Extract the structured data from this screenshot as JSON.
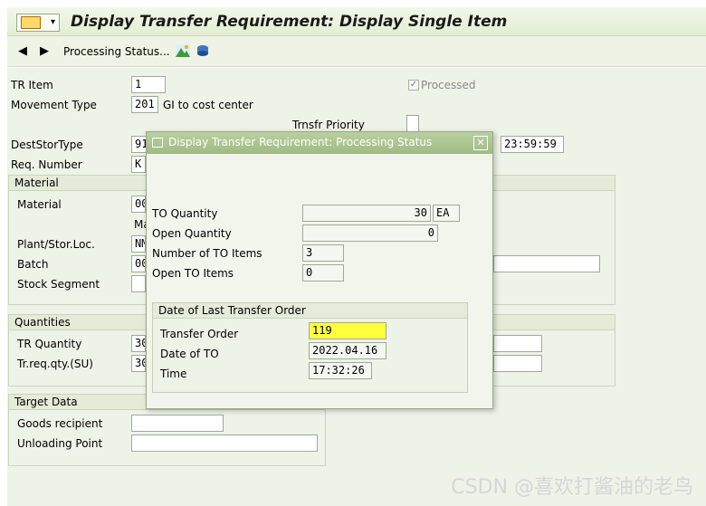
{
  "title": "Display Transfer Requirement: Display Single Item",
  "toolbar": {
    "back_icon": "triangle-left-icon",
    "forward_icon": "triangle-right-icon",
    "processing_status": "Processing Status...",
    "icon1": "mountain-landscape-icon",
    "icon2": "stack-icon"
  },
  "header": {
    "tr_item_label": "TR Item",
    "tr_item": "1",
    "processed_label": "Processed",
    "movement_type_label": "Movement Type",
    "movement_type": "201",
    "movement_type_desc": "GI to cost center",
    "trnsfr_priority_label": "Trnsfr Priority",
    "dest_stor_type_label": "DestStorType",
    "dest_stor_type": "91",
    "time_right": "23:59:59",
    "req_number_label": "Req. Number",
    "req_number": "K"
  },
  "material_group": {
    "title": "Material",
    "material_label": "Material",
    "material_value": "00",
    "ma_text": "Ma",
    "plant_label": "Plant/Stor.Loc.",
    "plant_value": "NM",
    "batch_label": "Batch",
    "batch_value": "00",
    "stock_segment_label": "Stock Segment"
  },
  "quantities_group": {
    "title": "Quantities",
    "tr_quantity_label": "TR Quantity",
    "tr_quantity": "30",
    "tr_req_qty_label": "Tr.req.qty.(SU)",
    "tr_req_qty": "30"
  },
  "target_group": {
    "title": "Target Data",
    "goods_recipient_label": "Goods recipient",
    "unloading_point_label": "Unloading Point"
  },
  "dialog": {
    "title": "Display Transfer Requirement: Processing Status",
    "to_quantity_label": "TO Quantity",
    "to_quantity": "30",
    "to_unit": "EA",
    "open_quantity_label": "Open Quantity",
    "open_quantity": "0",
    "num_to_items_label": "Number of TO Items",
    "num_to_items": "3",
    "open_to_items_label": "Open TO Items",
    "open_to_items": "0",
    "last_to_title": "Date of Last Transfer Order",
    "transfer_order_label": "Transfer Order",
    "transfer_order": "119",
    "date_of_to_label": "Date of TO",
    "date_of_to": "2022.04.16",
    "time_label": "Time",
    "time": "17:32:26"
  },
  "watermark": "CSDN @喜欢打酱油的老鸟",
  "colors": {
    "highlight": "#ffff3c",
    "dialog_title_bg": "#9fbb82",
    "bg": "#eef3e8"
  }
}
